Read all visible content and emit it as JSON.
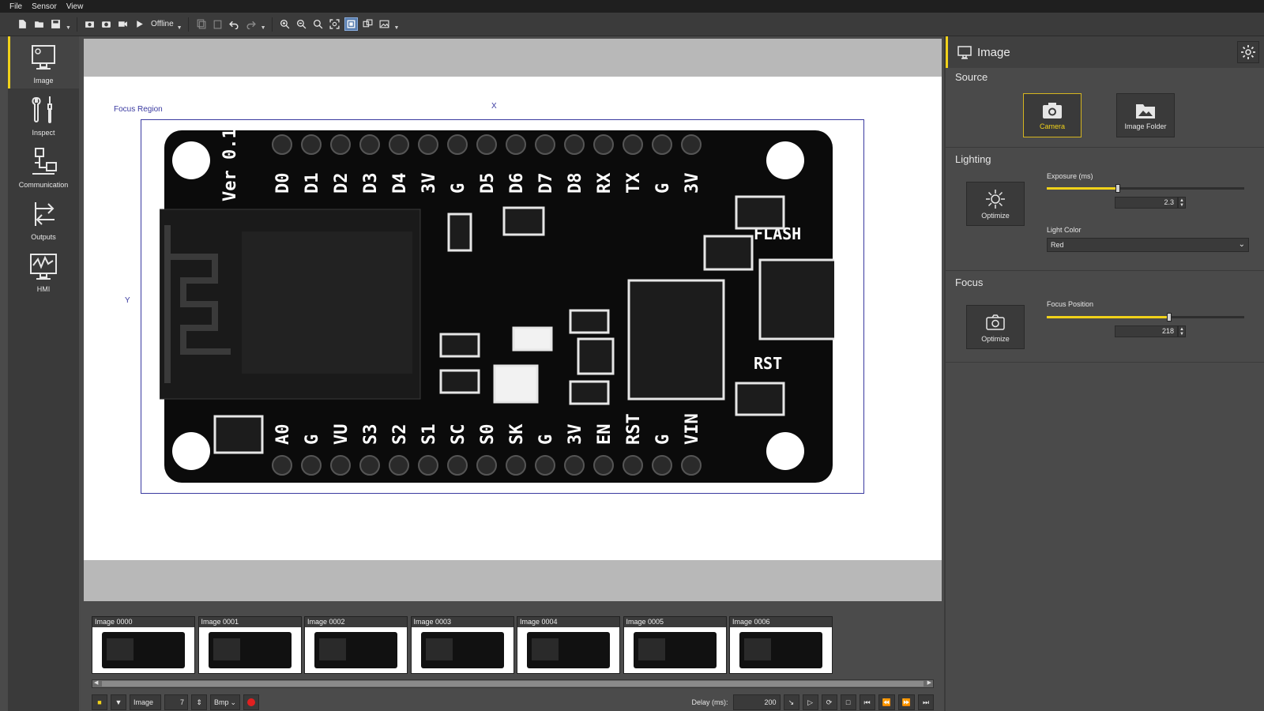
{
  "menu": [
    "File",
    "Sensor",
    "View"
  ],
  "toolbar": {
    "offline_label": "Offline"
  },
  "nav": [
    {
      "label": "Image",
      "icon": "monitor-icon"
    },
    {
      "label": "Inspect",
      "icon": "tools-icon"
    },
    {
      "label": "Communication",
      "icon": "network-icon"
    },
    {
      "label": "Outputs",
      "icon": "arrows-exchange-icon"
    },
    {
      "label": "HMI",
      "icon": "hmi-chart-icon"
    }
  ],
  "viewer": {
    "focus_region_label": "Focus Region",
    "x_marker": "X",
    "y_marker": "Y",
    "board_labels_top": [
      "D0",
      "D1",
      "D2",
      "D3",
      "D4",
      "3V",
      "G",
      "D5",
      "D6",
      "D7",
      "D8",
      "RX",
      "TX",
      "G",
      "3V"
    ],
    "board_labels_bottom": [
      "A0",
      "G",
      "VU",
      "S3",
      "S2",
      "S1",
      "SC",
      "S0",
      "SK",
      "G",
      "3V",
      "EN",
      "RST",
      "G",
      "VIN"
    ],
    "board_ver": "Ver 0.1",
    "board_flash": "FLASH",
    "board_rst": "RST"
  },
  "filmstrip": {
    "thumbnails": [
      "Image 0000",
      "Image 0001",
      "Image 0002",
      "Image 0003",
      "Image 0004",
      "Image 0005",
      "Image 0006"
    ]
  },
  "bottombar": {
    "source_select": "Image",
    "count_value": "7",
    "format_select": "Bmp",
    "delay_label": "Delay (ms):",
    "delay_value": "200"
  },
  "panel": {
    "title": "Image",
    "source_section": "Source",
    "camera_label": "Camera",
    "image_folder_label": "Image Folder",
    "lighting_section": "Lighting",
    "optimize_label": "Optimize",
    "exposure_label": "Exposure (ms)",
    "exposure_value": "2.3",
    "exposure_fraction": 0.36,
    "light_color_label": "Light Color",
    "light_color_value": "Red",
    "focus_section": "Focus",
    "focus_optimize_label": "Optimize",
    "focus_position_label": "Focus Position",
    "focus_position_value": "218",
    "focus_fraction": 0.62
  },
  "colors": {
    "accent": "#f1d21a",
    "focus_box": "#3a3aa0",
    "record": "#e02020"
  }
}
